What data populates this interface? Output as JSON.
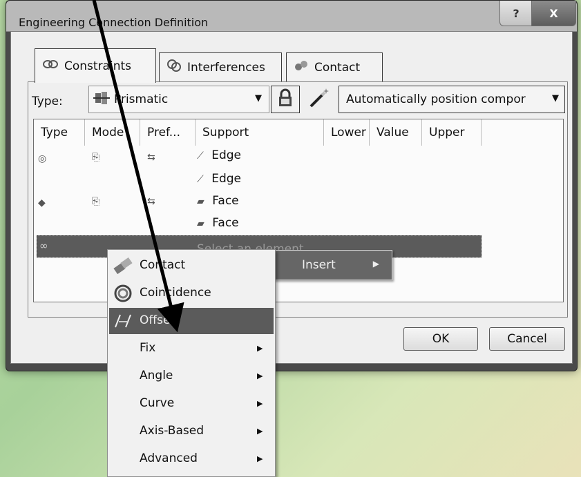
{
  "window": {
    "title": "Engineering Connection Definition",
    "help_label": "?",
    "close_label": "X"
  },
  "tabs": [
    {
      "label": "Constraints",
      "icon": "constraints-icon",
      "active": true
    },
    {
      "label": "Interferences",
      "icon": "interferences-icon"
    },
    {
      "label": "Contact",
      "icon": "contact-icon"
    }
  ],
  "type_row": {
    "label": "Type:",
    "selected": "Prismatic",
    "auto_position": "Automatically position compor"
  },
  "table": {
    "columns": [
      "Type",
      "Mode",
      "Pref...",
      "Support",
      "Lower",
      "Value",
      "Upper"
    ],
    "rows": [
      {
        "support": "Edge"
      },
      {
        "support": "Edge"
      },
      {
        "support": "Face"
      },
      {
        "support": "Face"
      },
      {
        "support": "Select an element"
      }
    ]
  },
  "buttons": {
    "ok": "OK",
    "cancel": "Cancel"
  },
  "submenu": {
    "insert": "Insert"
  },
  "context_menu": {
    "items": [
      {
        "label": "Contact",
        "icon": "contact-icon",
        "has_submenu": false
      },
      {
        "label": "Coincidence",
        "icon": "coincidence-icon",
        "has_submenu": false
      },
      {
        "label": "Offset",
        "icon": "offset-icon",
        "has_submenu": false,
        "highlighted": true
      },
      {
        "label": "Fix",
        "has_submenu": true
      },
      {
        "label": "Angle",
        "has_submenu": true
      },
      {
        "label": "Curve",
        "has_submenu": true
      },
      {
        "label": "Axis-Based",
        "has_submenu": true
      },
      {
        "label": "Advanced",
        "has_submenu": true
      }
    ]
  },
  "colors": {
    "highlight": "#5b5b5b",
    "background_gradient": "#b9dca6",
    "annotation_arrow": "#000000"
  }
}
